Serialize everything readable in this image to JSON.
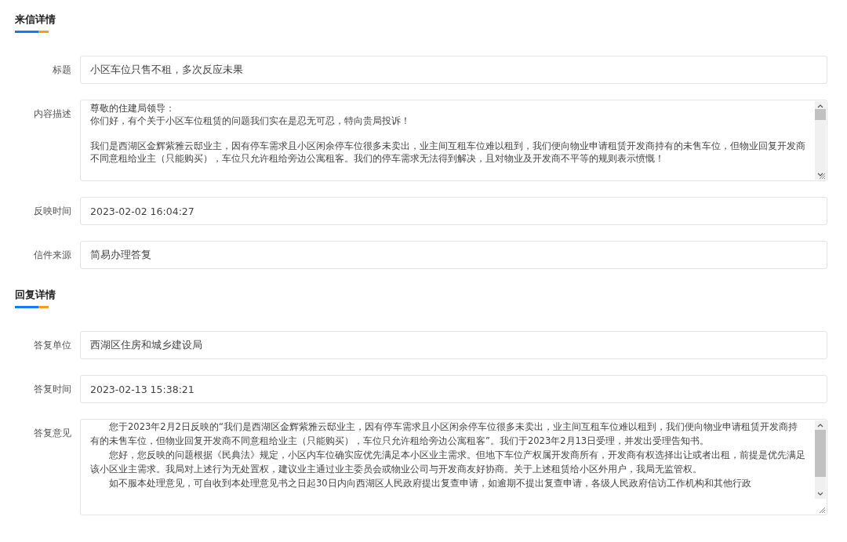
{
  "sections": [
    {
      "title": "来信详情",
      "fields": [
        {
          "kind": "input",
          "label": "标题",
          "value": "小区车位只售不租，多次反应未果"
        },
        {
          "kind": "textarea",
          "label": "内容描述",
          "spaced_last": true,
          "paragraphs": [
            "尊敬的住建局领导：",
            "你们好，有个关于小区车位租赁的问题我们实在是忍无可忍，特向贵局投诉！",
            "我们是西湖区金辉紫雅云邸业主，因有停车需求且小区闲余停车位很多未卖出，业主间互租车位难以租到，我们便向物业申请租赁开发商持有的未售车位，但物业回复开发商不同意租给业主（只能购买），车位只允许租给旁边公寓租客。我们的停车需求无法得到解决，且对物业及开发商不平等的规则表示愤慨！"
          ]
        },
        {
          "kind": "input",
          "label": "反映时间",
          "value": "2023-02-02 16:04:27"
        },
        {
          "kind": "input",
          "label": "信件来源",
          "value": "简易办理答复"
        }
      ]
    },
    {
      "title": "回复详情",
      "fields": [
        {
          "kind": "input",
          "label": "答复单位",
          "value": "西湖区住房和城乡建设局"
        },
        {
          "kind": "input",
          "label": "答复时间",
          "value": "2023-02-13 15:38:21"
        },
        {
          "kind": "textarea",
          "label": "答复意见",
          "spaced_last": false,
          "paragraphs": [
            "　　您于2023年2月2日反映的“我们是西湖区金辉紫雅云邸业主，因有停车需求且小区闲余停车位很多未卖出，业主间互租车位难以租到，我们便向物业申请租赁开发商持有的未售车位，但物业回复开发商不同意租给业主（只能购买），车位只允许租给旁边公寓租客”。我们于2023年2月13日受理，并发出受理告知书。",
            "　　您好，您反映的问题根据《民典法》规定，小区内车位确实应优先满足本小区业主需求。但地下车位产权属开发商所有，开发商有权选择出让或者出租，前提是优先满足该小区业主需求。我局对上述行为无处置权，建议业主通过业主委员会或物业公司与开发商友好协商。关于上述租赁给小区外用户，我局无监管权。",
            "　　如不服本处理意见，可自收到本处理意见书之日起30日内向西湖区人民政府提出复查申请，如逾期不提出复查申请，各级人民政府信访工作机构和其他行政"
          ]
        }
      ]
    }
  ]
}
